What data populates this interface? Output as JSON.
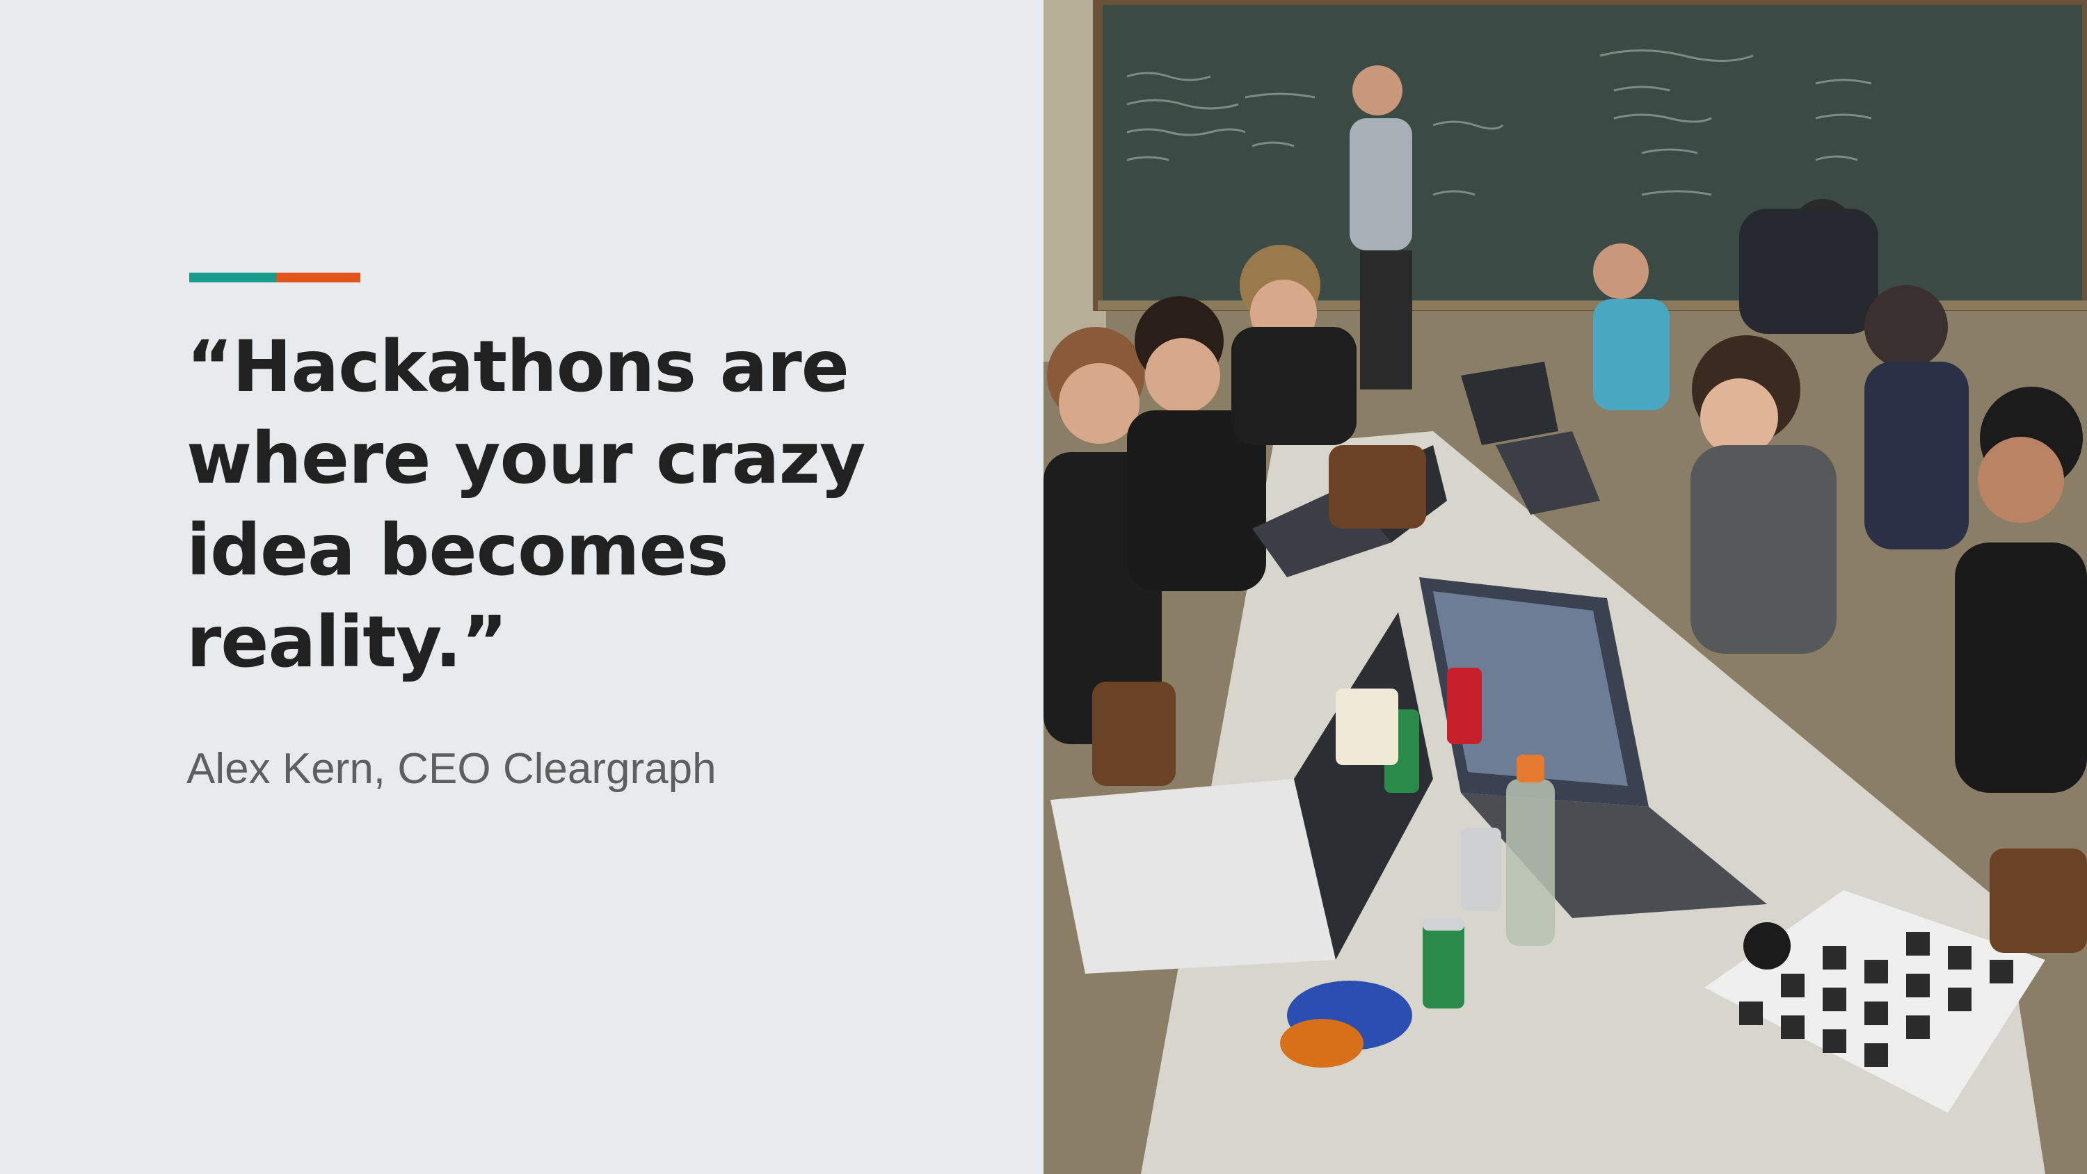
{
  "slide": {
    "quote": "“Hackathons are where your crazy idea becomes reality.”",
    "attribution": "Alex Kern, CEO Cleargraph"
  },
  "colors": {
    "background": "#e8ebed",
    "accent_teal": "#1a9a8b",
    "accent_orange": "#e2551a",
    "quote_text": "#212121",
    "attribution_text": "#5e5e5e"
  },
  "photo": {
    "icon": "hackathon-photo"
  }
}
